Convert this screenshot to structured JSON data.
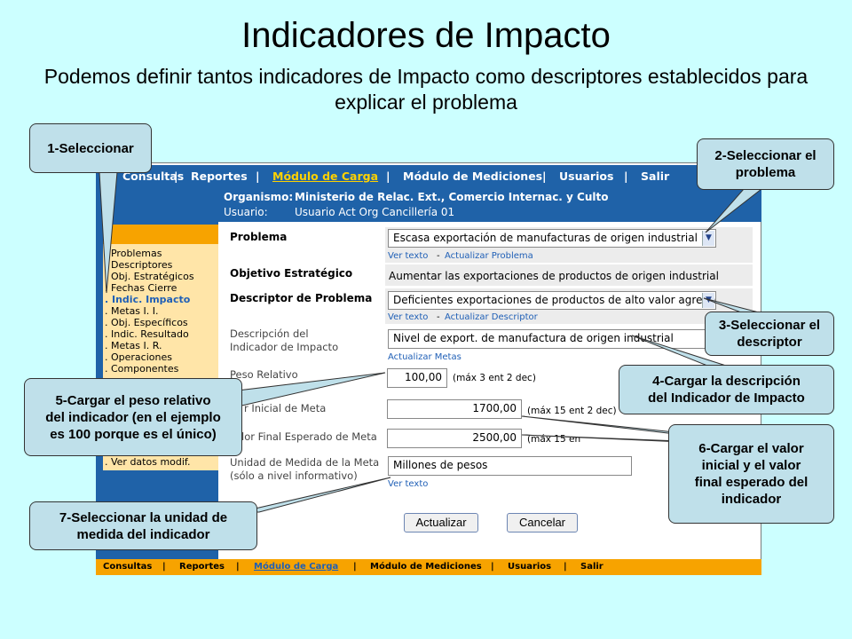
{
  "slide": {
    "title": "Indicadores de Impacto",
    "subtitle": "Podemos definir tantos indicadores de Impacto como descriptores establecidos para explicar el problema"
  },
  "top_nav": [
    {
      "label": "Consultas",
      "active": false
    },
    {
      "label": "Reportes",
      "active": false
    },
    {
      "label": "Módulo de Carga",
      "active": true
    },
    {
      "label": "Módulo de Mediciones",
      "active": false
    },
    {
      "label": "Usuarios",
      "active": false
    },
    {
      "label": "Salir",
      "active": false
    }
  ],
  "org": {
    "organismo_label": "Organismo:",
    "organismo_value": "Ministerio de Relac. Ext., Comercio Internac. y Culto",
    "usuario_label": "Usuario:",
    "usuario_value": "Usuario Act Org Cancillería 01"
  },
  "side_menu": [
    {
      "label": ". Problemas",
      "active": false
    },
    {
      "label": ". Descriptores",
      "active": false
    },
    {
      "label": ". Obj. Estratégicos",
      "active": false
    },
    {
      "label": ". Fechas Cierre",
      "active": false
    },
    {
      "label": ". Indic. Impacto",
      "active": true
    },
    {
      "label": ". Metas I. I.",
      "active": false
    },
    {
      "label": ". Obj. Específicos",
      "active": false
    },
    {
      "label": ". Indic. Resultado",
      "active": false
    },
    {
      "label": ". Metas I. R.",
      "active": false
    },
    {
      "label": ". Operaciones",
      "active": false
    },
    {
      "label": ". Componentes",
      "active": false
    },
    {
      "label": ". Ver datos modif.",
      "active": false
    }
  ],
  "form": {
    "problema_label": "Problema",
    "problema_value": "Escasa exportación de manufacturas de origen industrial",
    "ver_texto": "Ver texto",
    "dash": "-",
    "actualizar_problema": "Actualizar Problema",
    "objetivo_label": "Objetivo Estratégico",
    "objetivo_value": "Aumentar las exportaciones de productos de origen industrial",
    "descriptor_label": "Descriptor de Problema",
    "descriptor_value": "Deficientes exportaciones de productos de alto valor agregado",
    "actualizar_descriptor": "Actualizar Descriptor",
    "descripcion_label_1": "Descripción del",
    "descripcion_label_2": "Indicador de Impacto",
    "descripcion_value": "Nivel de export. de manufactura de origen industrial",
    "actualizar_metas": "Actualizar Metas",
    "peso_label": "Peso Relativo",
    "peso_value": "100,00",
    "peso_hint": "(máx 3 ent 2 dec)",
    "inicial_label": "r Inicial de Meta",
    "inicial_value": "1700,00",
    "inicial_hint": "(máx 15 ent 2 dec)",
    "final_label": "lor Final Esperado de Meta",
    "final_value": "2500,00",
    "final_hint": "(máx 15 en",
    "unidad_label_1": "Unidad de Medida de la Meta",
    "unidad_label_2": "(sólo a nivel informativo)",
    "unidad_value": "Millones de pesos",
    "ver_texto_unidad": "Ver texto",
    "actualizar_btn": "Actualizar",
    "cancelar_btn": "Cancelar"
  },
  "bottom_nav": [
    {
      "label": "Consultas",
      "active": false
    },
    {
      "label": "Reportes",
      "active": false
    },
    {
      "label": "Módulo de Carga",
      "active": true
    },
    {
      "label": "Módulo de Mediciones",
      "active": false
    },
    {
      "label": "Usuarios",
      "active": false
    },
    {
      "label": "Salir",
      "active": false
    }
  ],
  "callouts": {
    "c1": "1-Seleccionar",
    "c2_line1": "2-Seleccionar el",
    "c2_line2": "problema",
    "c3_line1": "3-Seleccionar el",
    "c3_line2": "descriptor",
    "c4_line1": "4-Cargar la descripción",
    "c4_line2": "del Indicador de Impacto",
    "c5_line1": "5-Cargar el peso relativo",
    "c5_line2": "del indicador (en el ejemplo",
    "c5_line3": "es 100 porque es el único)",
    "c6_line1": "6-Cargar el valor",
    "c6_line2": "inicial y el valor",
    "c6_line3": "final esperado del",
    "c6_line4": "indicador",
    "c7_line1": "7-Seleccionar la unidad de",
    "c7_line2": "medida del indicador"
  },
  "colors": {
    "background": "#ccffff",
    "nav_blue": "#1f62a8",
    "menu_orange": "#f7a300",
    "menu_cream": "#ffe5a8",
    "callout_fill": "#bfe0ea",
    "active_nav": "#ffd200"
  }
}
